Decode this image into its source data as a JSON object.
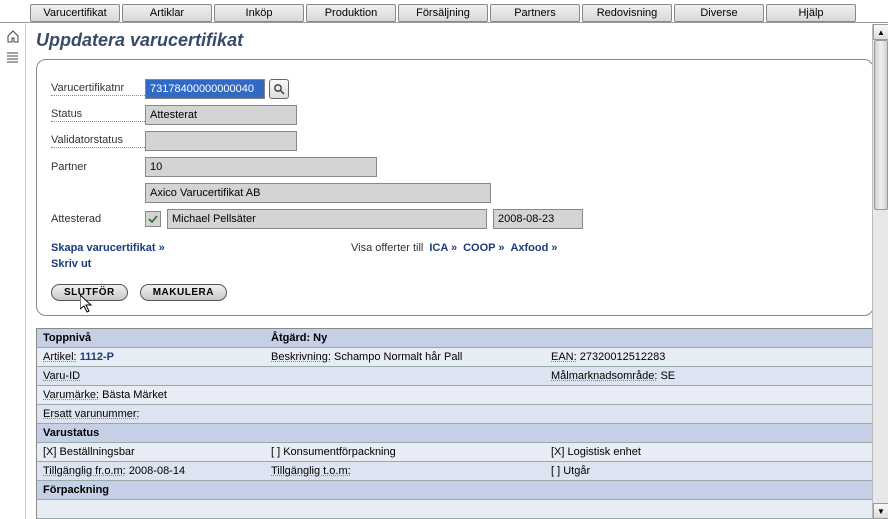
{
  "topmenu": [
    "Varucertifikat",
    "Artiklar",
    "Inköp",
    "Produktion",
    "Försäljning",
    "Partners",
    "Redovisning",
    "Diverse",
    "Hjälp"
  ],
  "page_title": "Uppdatera varucertifikat",
  "form": {
    "cert_label": "Varucertifikatnr",
    "cert_value": "73178400000000040",
    "status_label": "Status",
    "status_value": "Attesterat",
    "valstatus_label": "Validatorstatus",
    "valstatus_value": "",
    "partner_label": "Partner",
    "partner_value": "10",
    "partner_name": "Axico Varucertifikat AB",
    "attest_label": "Attesterad",
    "attest_person": "Michael Pellsäter",
    "attest_date": "2008-08-23"
  },
  "links": {
    "create": "Skapa varucertifikat »",
    "print": "Skriv ut",
    "show_offers": "Visa offerter till",
    "ica": "ICA »",
    "coop": "COOP »",
    "axfood": "Axfood »"
  },
  "buttons": {
    "finish": "SLUTFÖR",
    "cancel": "MAKULERA"
  },
  "detail": {
    "head_left": "Toppnivå",
    "head_right": "Åtgärd: Ny",
    "artikel_lbl": "Artikel:",
    "artikel_val": "1112-P",
    "beskr_lbl": "Beskrivning:",
    "beskr_val": "Schampo Normalt hår Pall",
    "ean_lbl": "EAN:",
    "ean_val": "27320012512283",
    "varuid_lbl": "Varu-ID",
    "market_lbl": "Målmarknadsområde:",
    "market_val": "SE",
    "brand_lbl": "Varumärke:",
    "brand_val": "Bästa Märket",
    "replace_lbl": "Ersatt varunummer:",
    "varustatus": "Varustatus",
    "order": "[X] Beställningsbar",
    "consumer": "[ ] Konsumentförpackning",
    "logistic": "[X] Logistisk enhet",
    "avail_from_lbl": "Tillgänglig fr.o.m:",
    "avail_from_val": "2008-08-14",
    "avail_to_lbl": "Tillgänglig t.o.m:",
    "expires": "[ ] Utgår",
    "forpack": "Förpackning"
  }
}
